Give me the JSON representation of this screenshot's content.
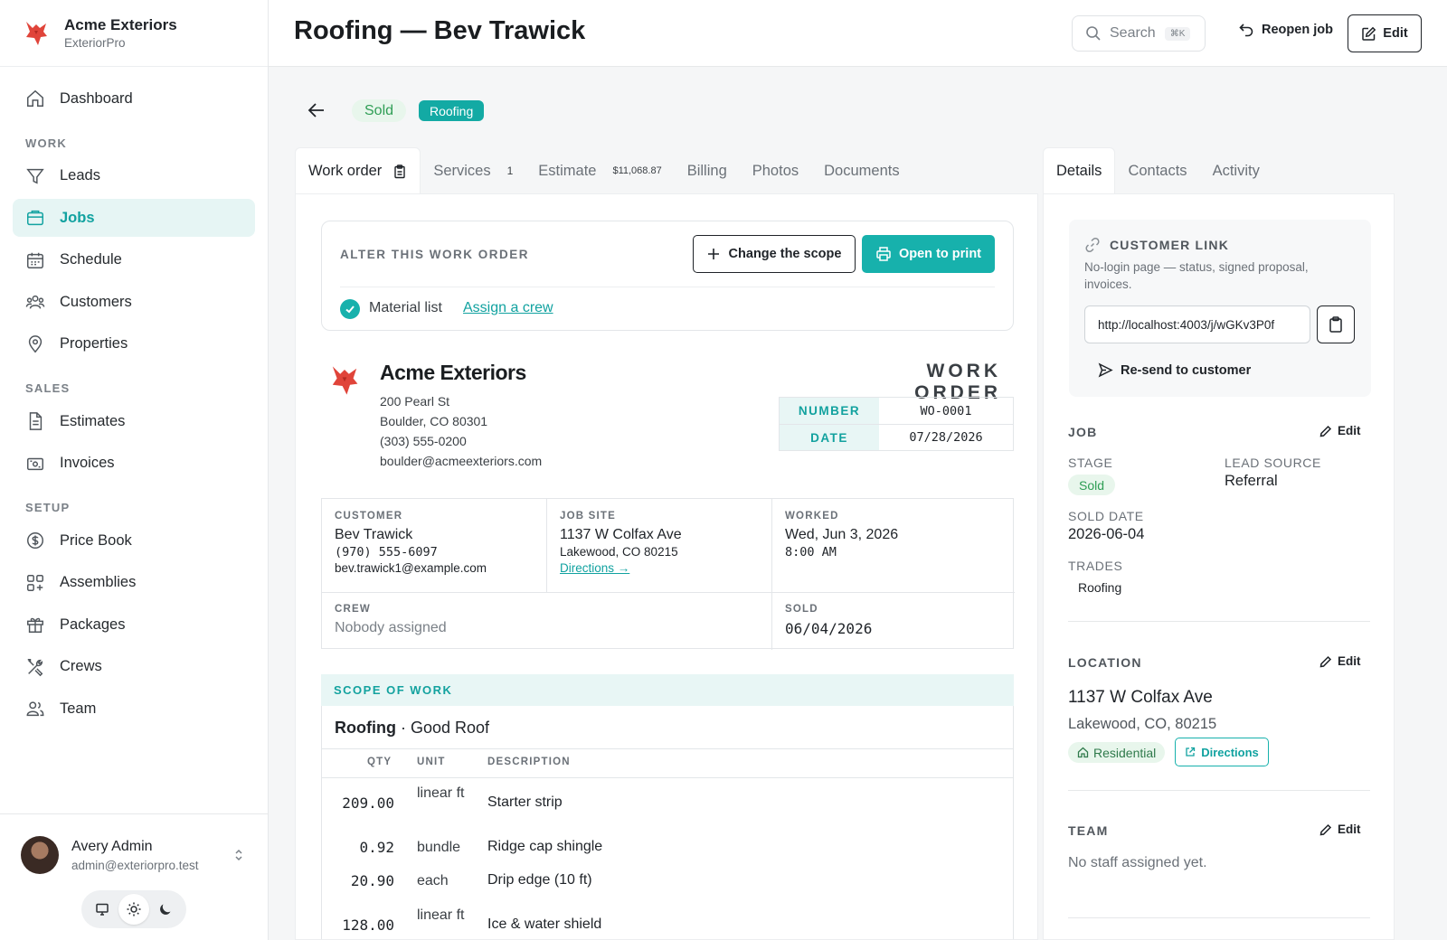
{
  "brand": {
    "name": "Acme Exteriors",
    "product": "ExteriorPro"
  },
  "nav": {
    "dashboard": "Dashboard",
    "work_section": "WORK",
    "leads": "Leads",
    "jobs": "Jobs",
    "schedule": "Schedule",
    "customers": "Customers",
    "properties": "Properties",
    "sales_section": "SALES",
    "estimates": "Estimates",
    "invoices": "Invoices",
    "setup_section": "SETUP",
    "price_book": "Price Book",
    "assemblies": "Assemblies",
    "packages": "Packages",
    "crews": "Crews",
    "team": "Team"
  },
  "user": {
    "name": "Avery Admin",
    "email": "admin@exteriorpro.test"
  },
  "header": {
    "title": "Roofing — Bev Trawick",
    "search_placeholder": "Search",
    "search_shortcut": "⌘K",
    "reopen": "Reopen job",
    "edit": "Edit"
  },
  "badges": {
    "status": "Sold",
    "trade": "Roofing"
  },
  "tabs": {
    "work_order": "Work order",
    "services": "Services",
    "services_count": "1",
    "estimate": "Estimate",
    "estimate_amount": "$11,068.87",
    "billing": "Billing",
    "photos": "Photos",
    "documents": "Documents"
  },
  "alter": {
    "title": "ALTER THIS WORK ORDER",
    "change_scope": "Change the scope",
    "open_print": "Open to print",
    "material_list": "Material list",
    "assign_crew": "Assign a crew"
  },
  "company": {
    "name": "Acme Exteriors",
    "street": "200 Pearl St",
    "city": "Boulder, CO 80301",
    "phone": "(303) 555-0200",
    "email": "boulder@acmeexteriors.com"
  },
  "work_order": {
    "heading": "WORK ORDER",
    "number_label": "NUMBER",
    "number": "WO-0001",
    "date_label": "DATE",
    "date": "07/28/2026"
  },
  "info": {
    "customer_label": "CUSTOMER",
    "customer_name": "Bev Trawick",
    "customer_phone": "(970) 555-6097",
    "customer_email": "bev.trawick1@example.com",
    "site_label": "JOB SITE",
    "site_street": "1137 W Colfax Ave",
    "site_city": "Lakewood, CO 80215",
    "directions": "Directions →",
    "worked_label": "WORKED",
    "worked_date": "Wed, Jun 3, 2026",
    "worked_time": "8:00 AM",
    "crew_label": "CREW",
    "crew_value": "Nobody assigned",
    "sold_label": "SOLD",
    "sold_value": "06/04/2026"
  },
  "scope": {
    "header": "SCOPE OF WORK",
    "trade": "Roofing",
    "package": " · Good Roof",
    "col_qty": "QTY",
    "col_unit": "UNIT",
    "col_desc": "DESCRIPTION",
    "items": [
      {
        "qty": "209.00",
        "unit": "linear ft",
        "desc": "Starter strip"
      },
      {
        "qty": "0.92",
        "unit": "bundle",
        "desc": "Ridge cap shingle"
      },
      {
        "qty": "20.90",
        "unit": "each",
        "desc": "Drip edge (10 ft)"
      },
      {
        "qty": "128.00",
        "unit": "linear ft",
        "desc": "Ice & water shield"
      }
    ]
  },
  "right_tabs": {
    "details": "Details",
    "contacts": "Contacts",
    "activity": "Activity"
  },
  "customer_link": {
    "title": "CUSTOMER LINK",
    "desc": "No-login page — status, signed proposal, invoices.",
    "url": "http://localhost:4003/j/wGKv3P0f",
    "resend": "Re-send to customer"
  },
  "job": {
    "title": "JOB",
    "edit": "Edit",
    "stage_label": "STAGE",
    "stage": "Sold",
    "lead_source_label": "LEAD SOURCE",
    "lead_source": "Referral",
    "sold_date_label": "SOLD DATE",
    "sold_date": "2026-06-04",
    "trades_label": "TRADES",
    "trade": "Roofing"
  },
  "location": {
    "title": "LOCATION",
    "edit": "Edit",
    "street": "1137 W Colfax Ave",
    "city": "Lakewood, CO, 80215",
    "type": "Residential",
    "directions": "Directions"
  },
  "team": {
    "title": "TEAM",
    "edit": "Edit",
    "empty": "No staff assigned yet."
  },
  "colors": {
    "accent": "#17b1ac",
    "brand_red": "#e0443a",
    "success": "#2f9e55"
  }
}
